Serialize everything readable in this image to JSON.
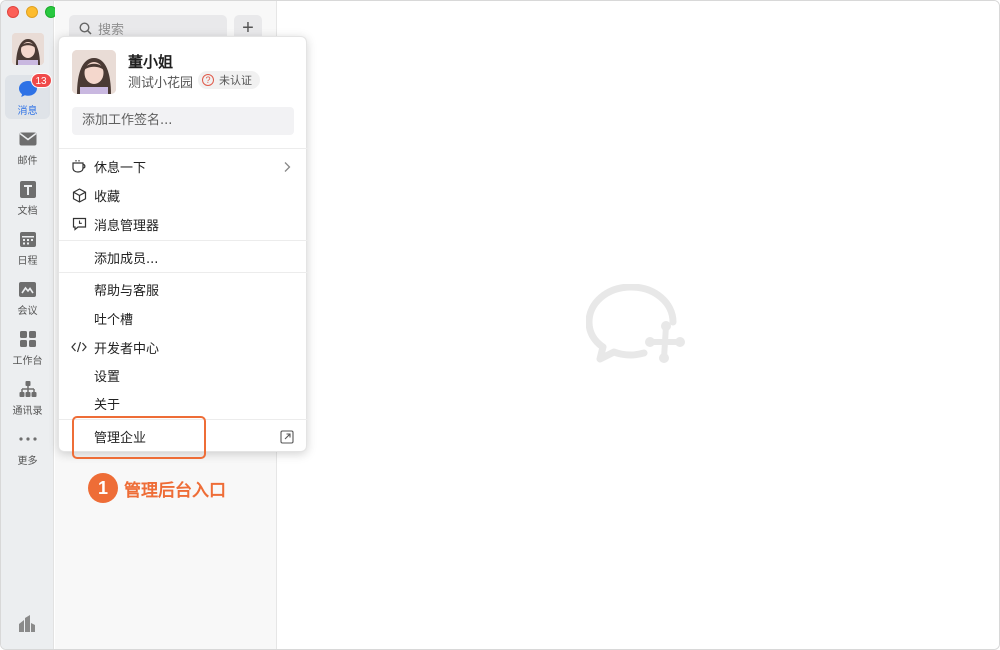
{
  "rail": {
    "items": [
      {
        "label": "消息",
        "icon": "chat-bubble-icon",
        "badge": "13",
        "active": true
      },
      {
        "label": "邮件",
        "icon": "mail-icon"
      },
      {
        "label": "文档",
        "icon": "document-icon"
      },
      {
        "label": "日程",
        "icon": "calendar-icon"
      },
      {
        "label": "会议",
        "icon": "meeting-icon"
      },
      {
        "label": "工作台",
        "icon": "workbench-icon"
      },
      {
        "label": "通讯录",
        "icon": "contacts-icon"
      },
      {
        "label": "更多",
        "icon": "more-icon"
      }
    ]
  },
  "list": {
    "search_placeholder": "搜索",
    "add_symbol": "+"
  },
  "profile": {
    "name": "董小姐",
    "org": "测试小花园",
    "cert_status": "未认证",
    "signature_placeholder": "添加工作签名..."
  },
  "menu": {
    "rest": "休息一下",
    "favorites": "收藏",
    "message_manager": "消息管理器",
    "add_member": "添加成员...",
    "help": "帮助与客服",
    "feedback": "吐个槽",
    "developer": "开发者中心",
    "settings": "设置",
    "about": "关于",
    "manage": "管理企业"
  },
  "callout": {
    "number": "1",
    "text": "管理后台入口"
  },
  "colors": {
    "accent": "#2e72e6",
    "highlight": "#ee6d37",
    "badge": "#f04a4a"
  }
}
